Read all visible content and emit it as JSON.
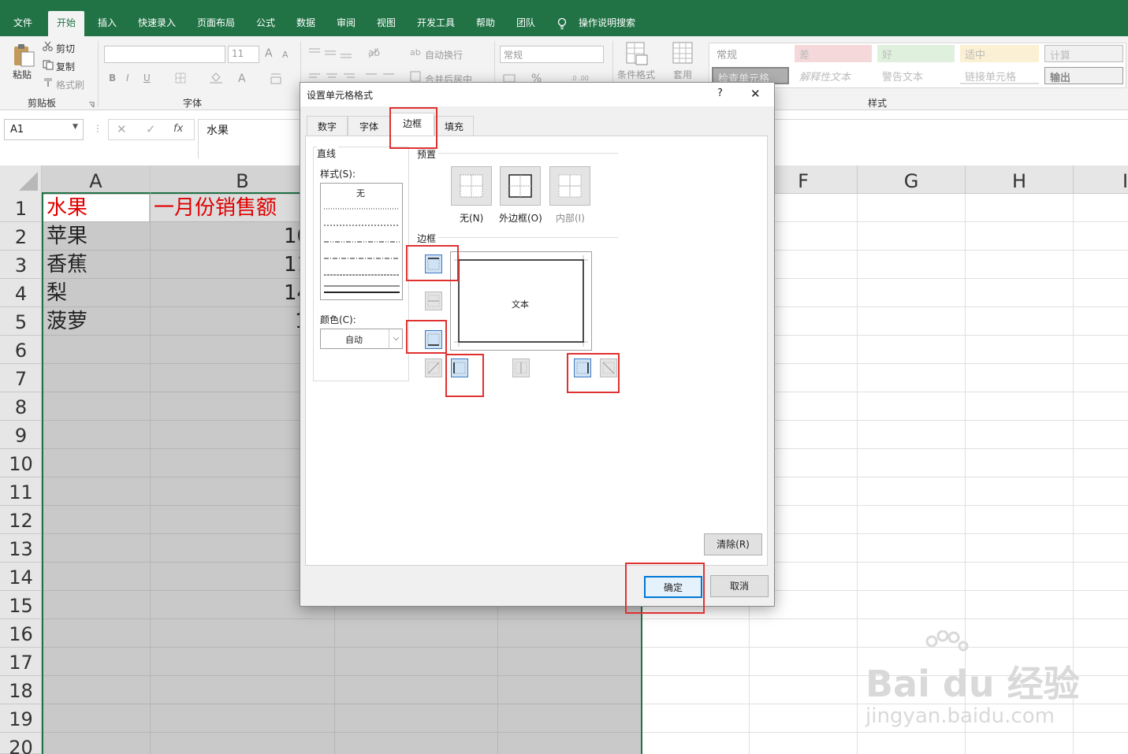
{
  "ribbon": {
    "tabs": [
      "文件",
      "开始",
      "插入",
      "快速录入",
      "页面布局",
      "公式",
      "数据",
      "审阅",
      "视图",
      "开发工具",
      "帮助",
      "团队",
      "操作说明搜索"
    ],
    "clipboard": {
      "paste": "粘贴",
      "cut": "剪切",
      "copy": "复制",
      "format_painter": "格式刷",
      "group": "剪贴板"
    },
    "font": {
      "size": "11",
      "bold": "B",
      "italic": "I",
      "underline": "U",
      "grow": "A",
      "shrink": "A",
      "group": "字体"
    },
    "alignment": {
      "wrap": "自动换行",
      "merge": "合并后居中"
    },
    "number": {
      "format": "常规",
      "percent": "%"
    },
    "styles": {
      "conditional": "条件格式",
      "table": "套用",
      "cells": [
        "常规",
        "差",
        "好",
        "适中",
        "计算",
        "检查单元格",
        "解释性文本",
        "警告文本",
        "链接单元格",
        "输出"
      ],
      "group": "样式"
    }
  },
  "formula_bar": {
    "name_box": "A1",
    "fx": "fx",
    "value": "水果"
  },
  "grid": {
    "columns": [
      "A",
      "B",
      "F",
      "G",
      "H",
      "I"
    ],
    "rows": [
      "1",
      "2",
      "3",
      "4",
      "5",
      "6",
      "7",
      "8",
      "9",
      "10",
      "11",
      "12",
      "13",
      "14",
      "15",
      "16",
      "17",
      "18",
      "19",
      "20"
    ],
    "cells": {
      "a1": "水果",
      "b1": "一月份销售额",
      "a2": "苹果",
      "b2": "10",
      "a3": "香蕉",
      "b3": "11",
      "a4": "梨",
      "b4": "14",
      "a5": "菠萝",
      "b5": "1"
    }
  },
  "dialog": {
    "title": "设置单元格格式",
    "help": "?",
    "close": "✕",
    "tabs": [
      "数字",
      "字体",
      "边框",
      "填充"
    ],
    "line_section": "直线",
    "style_label": "样式(S):",
    "style_none": "无",
    "color_label": "颜色(C):",
    "color_value": "自动",
    "preset_section": "预置",
    "presets": [
      "无(N)",
      "外边框(O)",
      "内部(I)"
    ],
    "border_section": "边框",
    "preview_text": "文本",
    "clear_button": "清除(R)",
    "ok_button": "确定",
    "cancel_button": "取消"
  },
  "watermark": {
    "brand": "Bai du 经验",
    "url": "jingyan.baidu.com"
  },
  "colors": {
    "excel_green": "#217346",
    "red_text": "#e00000",
    "highlight": "#e03131"
  }
}
